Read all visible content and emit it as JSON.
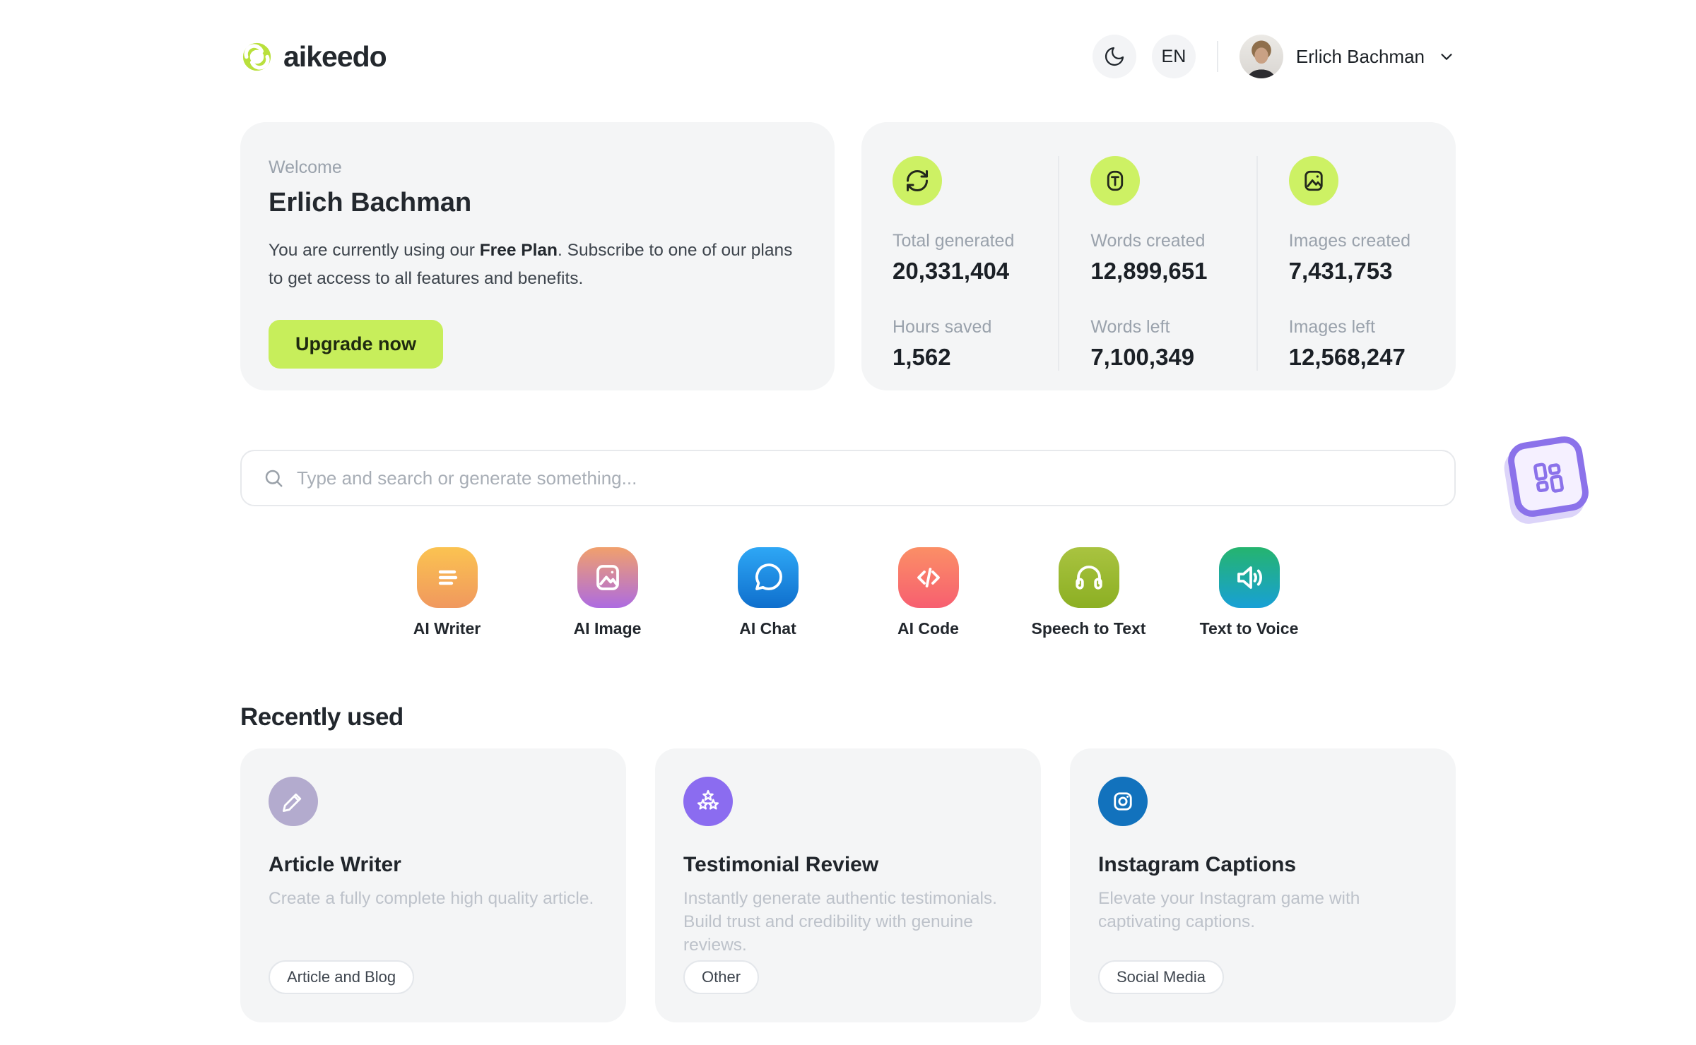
{
  "header": {
    "brand": "aikeedo",
    "language": "EN",
    "user_name": "Erlich Bachman"
  },
  "welcome": {
    "label": "Welcome",
    "name": "Erlich Bachman",
    "message_pre": "You are currently using our ",
    "plan": "Free Plan",
    "message_post": ". Subscribe to one of our plans to get access to all features and benefits.",
    "cta": "Upgrade now"
  },
  "stats": {
    "columns": [
      {
        "icon": "refresh-icon",
        "top_label": "Total generated",
        "top_value": "20,331,404",
        "bottom_label": "Hours saved",
        "bottom_value": "1,562"
      },
      {
        "icon": "text-icon",
        "top_label": "Words created",
        "top_value": "12,899,651",
        "bottom_label": "Words left",
        "bottom_value": "7,100,349"
      },
      {
        "icon": "image-icon",
        "top_label": "Images created",
        "top_value": "7,431,753",
        "bottom_label": "Images left",
        "bottom_value": "12,568,247"
      }
    ]
  },
  "search": {
    "placeholder": "Type and search or generate something..."
  },
  "tools": [
    {
      "label": "AI Writer",
      "icon": "writer-icon",
      "gradient": [
        "#fbc351",
        "#f0985e"
      ]
    },
    {
      "label": "AI Image",
      "icon": "image-icon",
      "gradient": [
        "#f1a06c",
        "#ad6be1"
      ]
    },
    {
      "label": "AI Chat",
      "icon": "chat-icon",
      "gradient": [
        "#2ea7f5",
        "#0f6fcd"
      ]
    },
    {
      "label": "AI Code",
      "icon": "code-icon",
      "gradient": [
        "#fb8f66",
        "#f75f70"
      ]
    },
    {
      "label": "Speech to Text",
      "icon": "headphones-icon",
      "gradient": [
        "#a9c340",
        "#8caf23"
      ]
    },
    {
      "label": "Text to Voice",
      "icon": "speaker-icon",
      "gradient": [
        "#25b46e",
        "#18a0d6"
      ]
    }
  ],
  "recent": {
    "heading": "Recently used",
    "cards": [
      {
        "title": "Article Writer",
        "description": "Create a fully complete high quality article.",
        "tag": "Article and Blog",
        "icon": "pencil-icon",
        "icon_bg": "#b3abce"
      },
      {
        "title": "Testimonial Review",
        "description": "Instantly generate authentic testimonials. Build trust and credibility with genuine reviews.",
        "tag": "Other",
        "icon": "stars-icon",
        "icon_bg": "#8b6cf0"
      },
      {
        "title": "Instagram Captions",
        "description": "Elevate your Instagram game with captivating captions.",
        "tag": "Social Media",
        "icon": "instagram-icon",
        "icon_bg": "#1272bd"
      }
    ]
  },
  "colors": {
    "accent_lime": "#c7ee5b",
    "stat_icon_bg": "#cdf164",
    "badge_purple": "#8b72ea"
  }
}
